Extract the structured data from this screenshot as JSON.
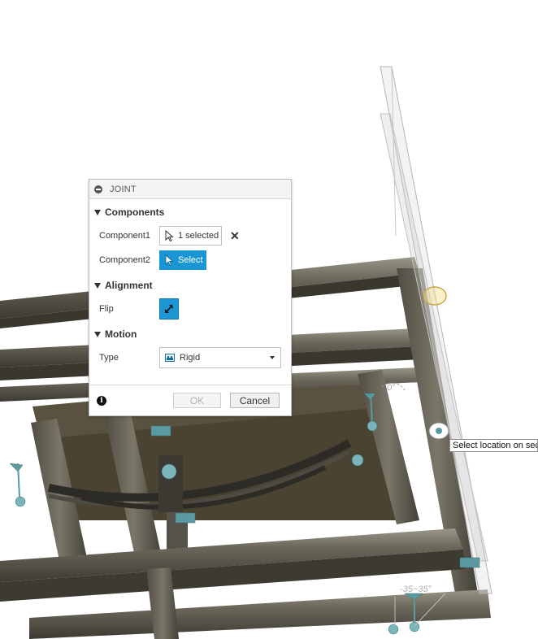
{
  "joint_panel": {
    "title": "JOINT",
    "sections": {
      "components": "Components",
      "alignment": "Alignment",
      "motion": "Motion"
    },
    "component1": {
      "label": "Component1",
      "value": "1 selected"
    },
    "component2": {
      "label": "Component2",
      "value": "Select"
    },
    "flip": {
      "label": "Flip"
    },
    "type": {
      "label": "Type",
      "value": "Rigid"
    },
    "buttons": {
      "ok": "OK",
      "cancel": "Cancel"
    }
  },
  "tooltip": "Select location on seco",
  "annotations": {
    "angle_top": "0°",
    "angle_bottom": "-35~35°"
  },
  "colors": {
    "accent": "#1a96d4",
    "frame_steel": "#6b6659",
    "glyph_teal": "#5a9aa0"
  },
  "icons": {
    "collapse": "minus-circle-icon",
    "cursor": "cursor-arrow-icon",
    "clear": "close-x-icon",
    "flip": "flip-arrows-icon",
    "rigid": "rigid-joint-icon",
    "info": "info-icon"
  }
}
